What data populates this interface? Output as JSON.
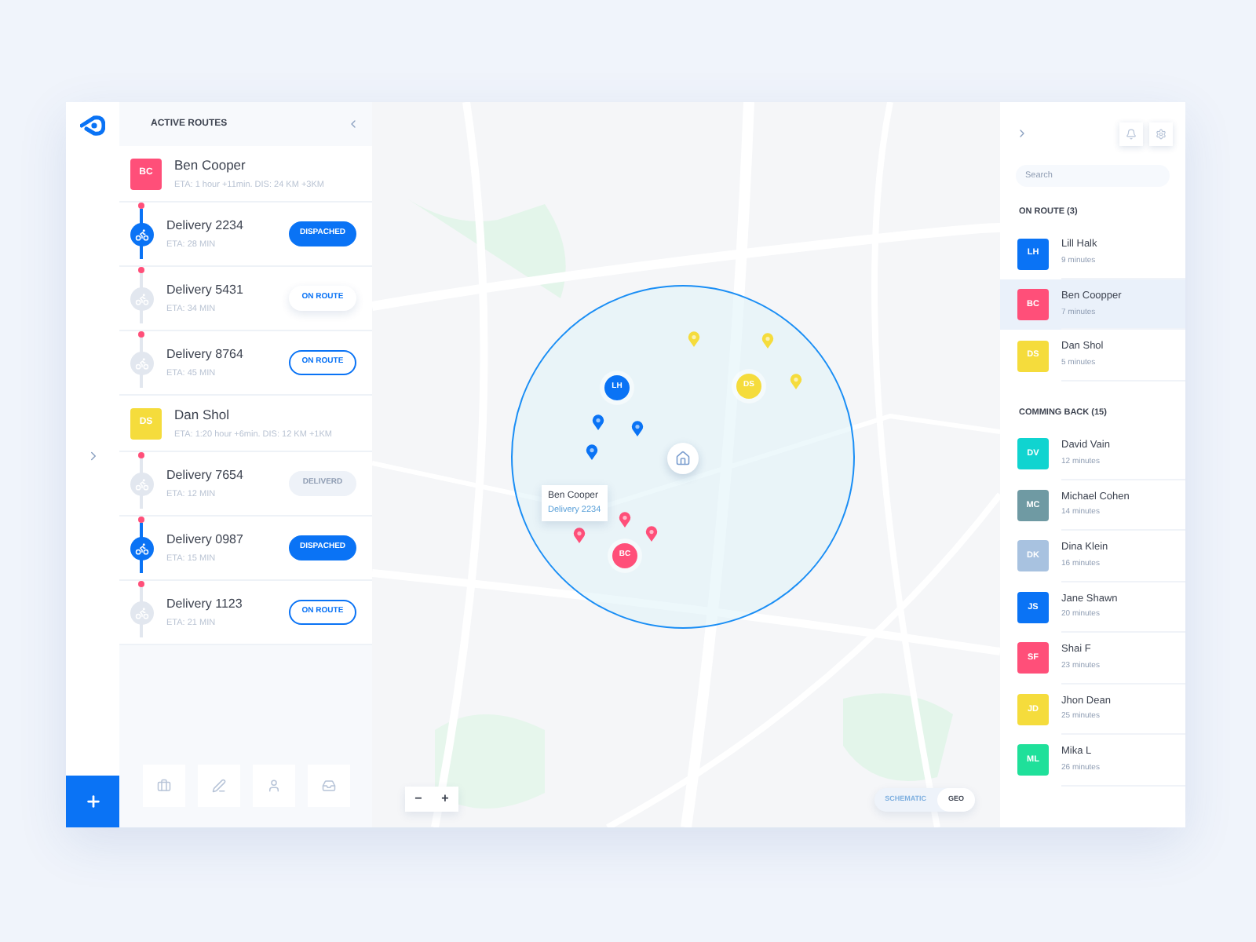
{
  "routes_panel": {
    "title": "ACTIVE ROUTES"
  },
  "routes": [
    {
      "initials": "BC",
      "color": "#ff4f79",
      "name": "Ben Cooper",
      "eta": "ETA: 1 hour +11min. DIS: 24 KM +3KM",
      "deliveries": [
        {
          "name": "Delivery 2234",
          "eta": "ETA: 28 MIN",
          "active": true,
          "status": {
            "label": "DISPACHED",
            "kind": "filled"
          }
        },
        {
          "name": "Delivery 5431",
          "eta": "ETA: 34 MIN",
          "active": false,
          "status": {
            "label": "ON ROUTE",
            "kind": "soft"
          }
        },
        {
          "name": "Delivery 8764",
          "eta": "ETA: 45 MIN",
          "active": false,
          "status": {
            "label": "ON ROUTE",
            "kind": "outline"
          }
        }
      ]
    },
    {
      "initials": "DS",
      "color": "#f5dc3c",
      "name": "Dan Shol",
      "eta": "ETA: 1:20 hour +6min. DIS: 12 KM +1KM",
      "deliveries": [
        {
          "name": "Delivery 7654",
          "eta": "ETA: 12 MIN",
          "active": false,
          "status": {
            "label": "DELIVERD",
            "kind": "muted"
          }
        },
        {
          "name": "Delivery 0987",
          "eta": "ETA: 15 MIN",
          "active": true,
          "status": {
            "label": "DISPACHED",
            "kind": "filled"
          }
        },
        {
          "name": "Delivery 1123",
          "eta": "ETA: 21 MIN",
          "active": false,
          "status": {
            "label": "ON ROUTE",
            "kind": "outline"
          }
        }
      ]
    }
  ],
  "map": {
    "markers": [
      {
        "kind": "avatar",
        "color": "#0a73f5",
        "initials": "LH"
      },
      {
        "kind": "avatar",
        "color": "#f5dc3c",
        "initials": "DS"
      },
      {
        "kind": "avatar",
        "color": "#ff4f79",
        "initials": "BC"
      },
      {
        "kind": "home"
      },
      {
        "kind": "pin",
        "color": "#0a73f5"
      },
      {
        "kind": "pin",
        "color": "#0a73f5"
      },
      {
        "kind": "pin",
        "color": "#0a73f5"
      },
      {
        "kind": "pin",
        "color": "#f5dc3c"
      },
      {
        "kind": "pin",
        "color": "#f5dc3c"
      },
      {
        "kind": "pin",
        "color": "#f5dc3c"
      },
      {
        "kind": "pin",
        "color": "#ff4f79"
      },
      {
        "kind": "pin",
        "color": "#ff4f79"
      },
      {
        "kind": "pin",
        "color": "#ff4f79"
      }
    ],
    "tooltip": {
      "title": "Ben Cooper",
      "subtitle": "Delivery 2234"
    },
    "zoom": [
      "−",
      "+"
    ],
    "views": [
      {
        "label": "SCHEMATIC",
        "selected": false
      },
      {
        "label": "GEO",
        "selected": true
      }
    ]
  },
  "search": {
    "placeholder": "Search"
  },
  "sections": [
    {
      "title": "ON ROUTE (3)",
      "people": [
        {
          "initials": "LH",
          "color": "#0a73f5",
          "name": "Lill Halk",
          "time": "9 minutes",
          "selected": false
        },
        {
          "initials": "BC",
          "color": "#ff4f79",
          "name": "Ben Coopper",
          "time": "7 minutes",
          "selected": true
        },
        {
          "initials": "DS",
          "color": "#f5dc3c",
          "name": "Dan Shol",
          "time": "5 minutes",
          "selected": false
        }
      ]
    },
    {
      "title": "COMMING BACK (15)",
      "people": [
        {
          "initials": "DV",
          "color": "#10d4d0",
          "name": "David Vain",
          "time": "12 minutes",
          "selected": false
        },
        {
          "initials": "MC",
          "color": "#6f9aa3",
          "name": "Michael Cohen",
          "time": "14 minutes",
          "selected": false
        },
        {
          "initials": "DK",
          "color": "#a8c2e0",
          "name": "Dina Klein",
          "time": "16 minutes",
          "selected": false
        },
        {
          "initials": "JS",
          "color": "#0a73f5",
          "name": "Jane Shawn",
          "time": "20 minutes",
          "selected": false
        },
        {
          "initials": "SF",
          "color": "#ff4f79",
          "name": "Shai F",
          "time": "23 minutes",
          "selected": false
        },
        {
          "initials": "JD",
          "color": "#f5dc3c",
          "name": "Jhon Dean",
          "time": "25 minutes",
          "selected": false
        },
        {
          "initials": "ML",
          "color": "#1fe09a",
          "name": "Mika L",
          "time": "26 minutes",
          "selected": false
        }
      ]
    }
  ]
}
